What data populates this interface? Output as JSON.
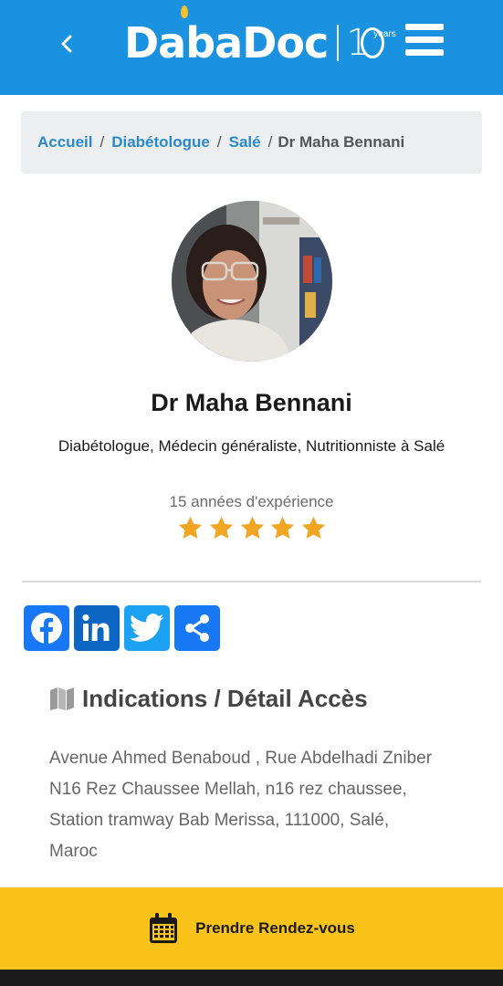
{
  "header": {
    "logo_text": "DabaDoc",
    "anniversary_years": "years",
    "colors": {
      "background": "#1b92df",
      "logo": "#ffffff"
    }
  },
  "breadcrumb": {
    "home": "Accueil",
    "specialty": "Diabétologue",
    "city": "Salé",
    "current": "Dr Maha Bennani",
    "separator": "/"
  },
  "profile": {
    "name": "Dr Maha Bennani",
    "specialties": "Diabétologue, Médecin généraliste, Nutritionniste à Salé",
    "experience": "15 années d'expérience",
    "rating": 5,
    "rating_max": 5,
    "star_color": "#f0a623"
  },
  "share": {
    "buttons": [
      {
        "name": "facebook",
        "icon": "facebook-icon",
        "color": "#1877f2"
      },
      {
        "name": "linkedin",
        "icon": "linkedin-icon",
        "color": "#0a66c2"
      },
      {
        "name": "twitter",
        "icon": "twitter-icon",
        "color": "#1da1f2"
      },
      {
        "name": "share",
        "icon": "share-icon",
        "color": "#1877f2"
      }
    ]
  },
  "indications": {
    "title": "Indications / Détail Accès",
    "icon": "map-icon",
    "address": "Avenue Ahmed Benaboud , Rue Abdelhadi Zniber N16 Rez Chaussee Mellah, n16 rez chaussee, Station tramway Bab Merissa, 111000, Salé, Maroc"
  },
  "cta": {
    "label": "Prendre Rendez-vous",
    "icon": "calendar-icon",
    "color": "#fbc21a"
  }
}
